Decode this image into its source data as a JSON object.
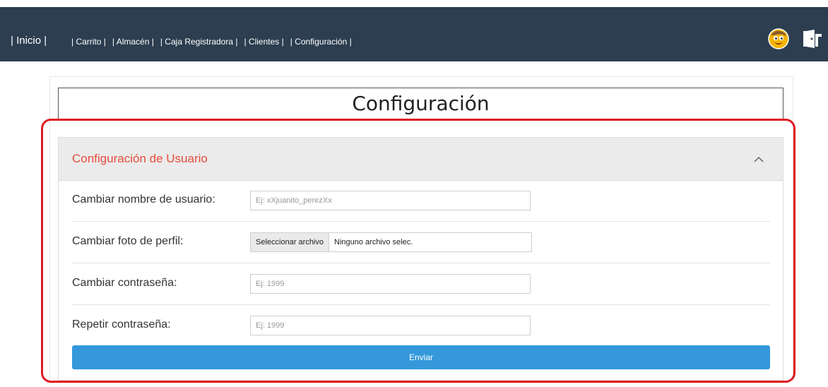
{
  "navbar": {
    "brand": "| Inicio |",
    "links": [
      "| Carrito |",
      "| Almacén |",
      "| Caja Registradora |",
      "| Clientes |",
      "| Configuración |"
    ],
    "bg_color": "#2c3e50",
    "icons": [
      "avatar-smiley-icon",
      "exit-door-icon"
    ]
  },
  "page": {
    "title": "Configuración"
  },
  "card": {
    "title": "Configuración de Usuario",
    "title_color": "#e74c3c",
    "rows": [
      {
        "label": "Cambiar nombre de usuario:",
        "placeholder": "Ej: xXjuanito_perezXx"
      },
      {
        "label": "Cambiar foto de perfil:",
        "file_button": "Seleccionar archivo",
        "file_status": "Ninguno archivo selec."
      },
      {
        "label": "Cambiar contraseña:",
        "placeholder": "Ej: 1999"
      },
      {
        "label": "Repetir contraseña:",
        "placeholder": "Ej: 1999"
      }
    ],
    "submit_label": "Enviar",
    "submit_color": "#3498db"
  },
  "highlight_color": "#e01b24"
}
